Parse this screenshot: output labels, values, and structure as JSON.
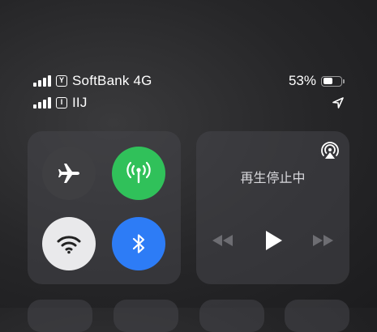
{
  "status_bar": {
    "carrier_primary": {
      "sim_badge": "Y",
      "name": "SoftBank 4G",
      "signal_icon": "cellular-signal-icon"
    },
    "carrier_secondary": {
      "sim_badge": "I",
      "name": "IIJ",
      "signal_icon": "cellular-signal-icon"
    },
    "battery_text": "53%",
    "battery_level": 0.53,
    "location_icon": "location-arrow-icon"
  },
  "connectivity": {
    "airplane": {
      "icon": "airplane-icon",
      "active": false,
      "color": "#3f3f42"
    },
    "cellular": {
      "icon": "cellular-antenna-icon",
      "active": true,
      "color": "#30c15a"
    },
    "wifi": {
      "icon": "wifi-icon",
      "active": true,
      "color": "#e9e9eb"
    },
    "bluetooth": {
      "icon": "bluetooth-icon",
      "active": true,
      "color": "#2d7cf6"
    }
  },
  "media": {
    "status_text": "再生停止中",
    "airplay_icon": "airplay-icon",
    "prev_icon": "rewind-icon",
    "play_icon": "play-icon",
    "next_icon": "fast-forward-icon"
  }
}
